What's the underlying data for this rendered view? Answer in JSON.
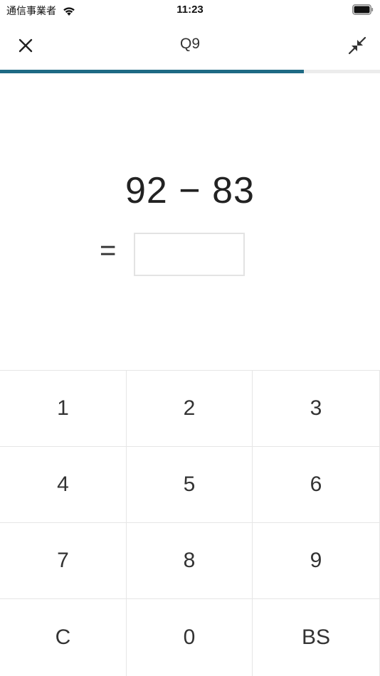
{
  "status_bar": {
    "carrier": "通信事業者",
    "time": "11:23"
  },
  "nav": {
    "title": "Q9",
    "close_icon": "close-icon",
    "shrink_icon": "shrink-icon"
  },
  "progress": {
    "fraction": 0.8,
    "color": "#1e6a84"
  },
  "question": {
    "expression": "92 − 83",
    "equals": "=",
    "answer": ""
  },
  "keypad": {
    "keys": [
      "1",
      "2",
      "3",
      "4",
      "5",
      "6",
      "7",
      "8",
      "9",
      "C",
      "0",
      "BS"
    ]
  }
}
